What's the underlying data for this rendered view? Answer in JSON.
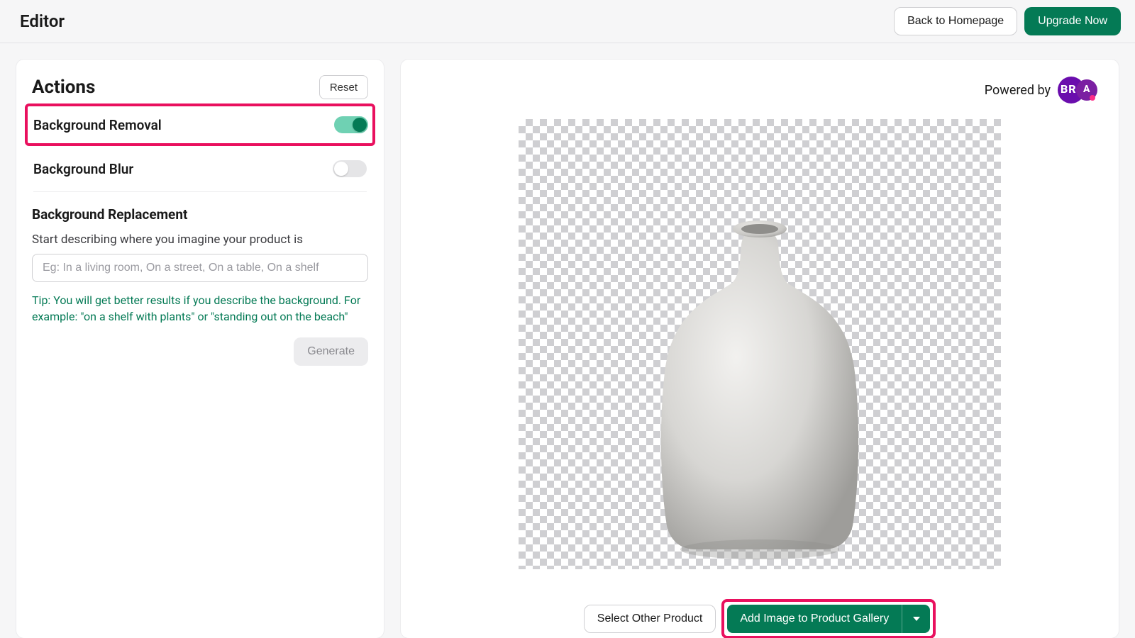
{
  "header": {
    "title": "Editor",
    "back_label": "Back to Homepage",
    "upgrade_label": "Upgrade Now"
  },
  "actions": {
    "title": "Actions",
    "reset_label": "Reset",
    "bg_removal_label": "Background Removal",
    "bg_removal_on": true,
    "bg_blur_label": "Background Blur",
    "bg_blur_on": false,
    "bg_replacement_title": "Background Replacement",
    "bg_replacement_prompt_label": "Start describing where you imagine your product is",
    "bg_replacement_placeholder": "Eg: In a living room, On a street, On a table, On a shelf",
    "tip_text": "Tip: You will get better results if you describe the background. For example: \"on a shelf with plants\" or \"standing out on the beach\"",
    "generate_label": "Generate"
  },
  "preview": {
    "powered_by_label": "Powered by",
    "brand": "BRIA",
    "select_other_label": "Select Other Product",
    "add_to_gallery_label": "Add Image to Product Gallery"
  }
}
